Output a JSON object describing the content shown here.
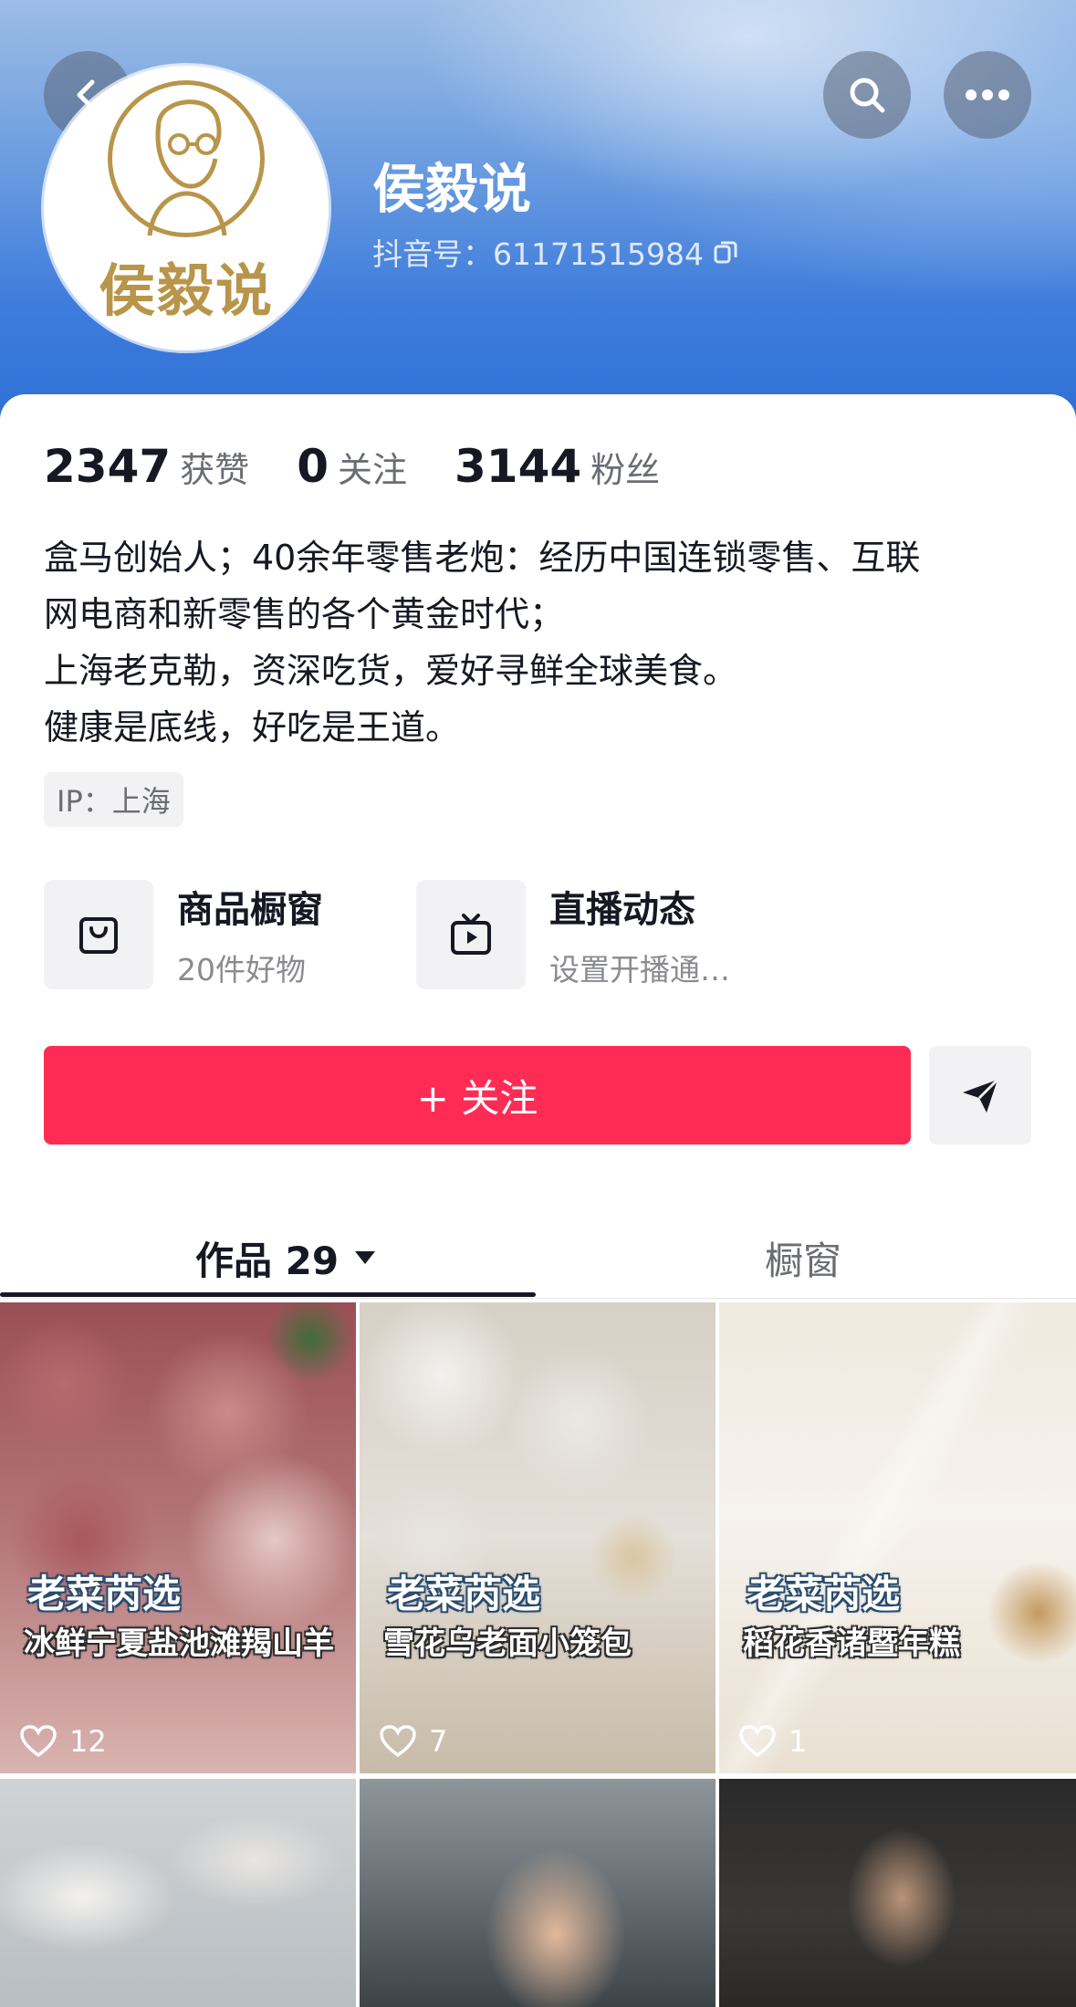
{
  "profile": {
    "name": "侯毅说",
    "douyin_id": "抖音号：61171515984",
    "avatar_text": "侯毅说"
  },
  "stats": [
    {
      "num": "2347",
      "label": "获赞"
    },
    {
      "num": "0",
      "label": "关注"
    },
    {
      "num": "3144",
      "label": "粉丝"
    }
  ],
  "bio": [
    "盒马创始人；40余年零售老炮：经历中国连锁零售、互联",
    "网电商和新零售的各个黄金时代；",
    "上海老克勒，资深吃货，爱好寻鲜全球美食。",
    "健康是底线，好吃是王道。"
  ],
  "ip": "IP：上海",
  "features": [
    {
      "title": "商品橱窗",
      "sub": "20件好物",
      "icon": "shopping-bag-icon"
    },
    {
      "title": "直播动态",
      "sub": "设置开播通…",
      "icon": "tv-play-icon"
    }
  ],
  "actions": {
    "follow_label": "+ 关注"
  },
  "tabs": [
    {
      "label": "作品 29"
    },
    {
      "label": "橱窗"
    }
  ],
  "videos": [
    {
      "tag": "老菜芮选",
      "title": "冰鲜宁夏盐池滩羯山羊",
      "likes": "12"
    },
    {
      "tag": "老菜芮选",
      "title": "雪花乌老面小笼包",
      "likes": "7"
    },
    {
      "tag": "老菜芮选",
      "title": "稻花香诸暨年糕",
      "likes": "1"
    }
  ],
  "colors": {
    "accent": "#fe2c55",
    "banner": "#3f7ddc",
    "avatar_gold": "#b8954a"
  }
}
